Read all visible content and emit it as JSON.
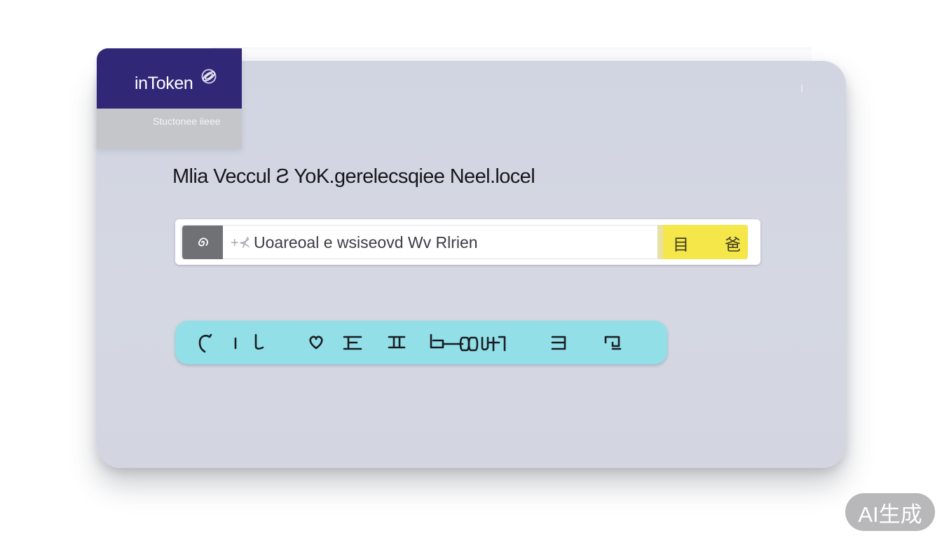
{
  "brand": {
    "name": "inToken",
    "subtitle": "Stuctonee iieee",
    "logo_icon": "ring-logo-icon",
    "header_color": "#312777"
  },
  "headline": "Mlia Veccul Ƨ YoK.gerelecsqiee Neel.locel",
  "search": {
    "prefix": "+⊀",
    "placeholder": "Uoareoal e wsiseovd Wv Rlrien",
    "value": "",
    "icon": "spiral-icon",
    "actions": [
      {
        "glyph": "目",
        "icon": "list-icon"
      },
      {
        "glyph": "爸",
        "icon": "glyph-icon"
      }
    ]
  },
  "toolbar": {
    "items": [
      {
        "name": "curve-c-tool",
        "icon": "curve-icon"
      },
      {
        "name": "line-tool",
        "icon": "line-icon"
      },
      {
        "name": "hook-tool",
        "icon": "hook-icon"
      },
      {
        "name": "heart-tool",
        "icon": "heart-icon"
      },
      {
        "name": "align-tool",
        "icon": "align-icon"
      },
      {
        "name": "column-tool",
        "icon": "column-icon"
      },
      {
        "name": "chain-tool",
        "icon": "chain-icon"
      },
      {
        "name": "box-tool",
        "icon": "box-icon"
      },
      {
        "name": "frame-tool",
        "icon": "frame-icon"
      }
    ]
  },
  "watermark": "AI生成",
  "colors": {
    "card": "#d3d6e1",
    "search_action": "#f5e74a",
    "toolbar": "#92dfe8"
  }
}
